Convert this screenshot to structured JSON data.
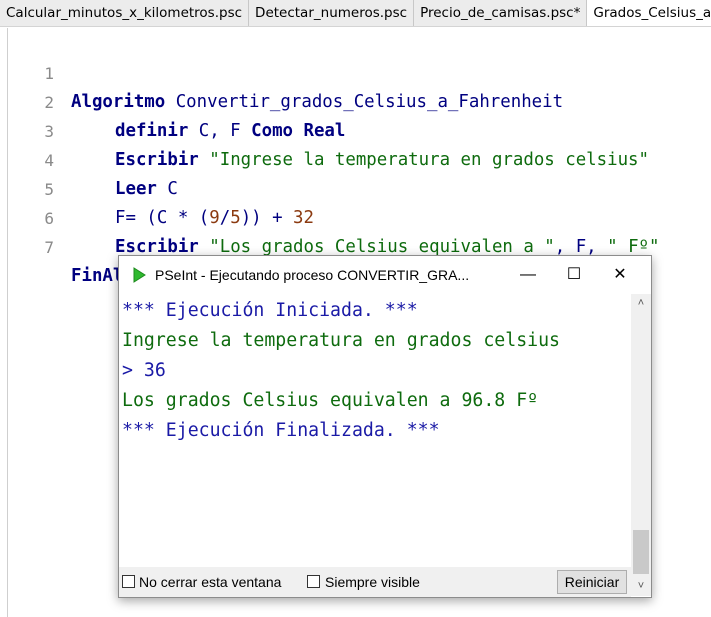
{
  "tabs": [
    {
      "label": "Calcular_minutos_x_kilometros.psc"
    },
    {
      "label": "Detectar_numeros.psc"
    },
    {
      "label": "Precio_de_camisas.psc*"
    },
    {
      "label": "Grados_Celsius_a_Fahrenheit.psc"
    }
  ],
  "editor": {
    "lines": [
      {
        "num": "1",
        "kw1": "Algoritmo",
        "rest": " Convertir_grados_Celsius_a_Fahrenheit"
      },
      {
        "num": "2",
        "kw1": "definir",
        "mid": " C, F ",
        "kw2": "Como Real"
      },
      {
        "num": "3",
        "kw1": "Escribir",
        "str": "\"Ingrese la temperatura en grados celsius\""
      },
      {
        "num": "4",
        "kw1": "Leer",
        "rest": " C"
      },
      {
        "num": "5",
        "a": "F= (C * (",
        "n1": "9",
        "b": "/",
        "n2": "5",
        "c": ")) + ",
        "n3": "32"
      },
      {
        "num": "6",
        "kw1": "Escribir",
        "str1": "\"Los grados Celsius equivalen a \"",
        "mid": ", F, ",
        "str2": "\" Fº\""
      },
      {
        "num": "7",
        "kw1": "FinAlgoritmo"
      }
    ]
  },
  "console_window": {
    "title": "PSeInt - Ejecutando proceso CONVERTIR_GRA...",
    "minimize": "—",
    "maximize": "☐",
    "close": "✕",
    "output": [
      {
        "text": "*** Ejecución Iniciada. ***",
        "color": "blue"
      },
      {
        "text": "Ingrese la temperatura en grados celsius",
        "color": "green"
      },
      {
        "text": "> 36",
        "color": "blue"
      },
      {
        "text": "Los grados Celsius equivalen a 96.8 Fº",
        "color": "green"
      },
      {
        "text": "*** Ejecución Finalizada. ***",
        "color": "blue"
      }
    ],
    "checkbox_keep_open": "No cerrar esta ventana",
    "checkbox_always_visible": "Siempre visible",
    "restart_button": "Reiniciar"
  }
}
